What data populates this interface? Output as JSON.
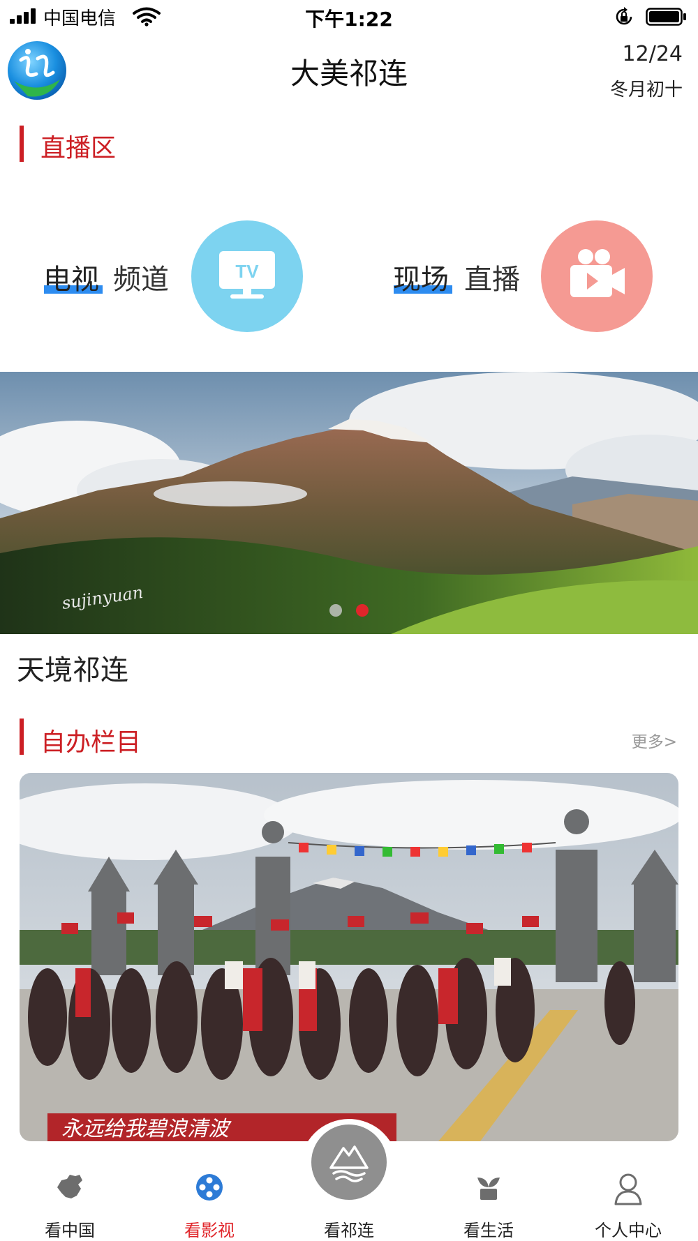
{
  "status_bar": {
    "carrier": "中国电信",
    "time": "下午1:22",
    "icons": [
      "signal-icon",
      "wifi-icon",
      "rotation-lock-icon",
      "battery-icon"
    ]
  },
  "header": {
    "title": "大美祁连",
    "date": "12/24",
    "lunar_date": "冬月初十",
    "logo_icon": "app-logo"
  },
  "live_section": {
    "title": "直播区",
    "items": [
      {
        "strong": "电视",
        "light": "频道",
        "icon_label": "TV",
        "icon": "tv-icon",
        "color": "#7dd3f0"
      },
      {
        "strong": "现场",
        "light": "直播",
        "icon": "video-camera-icon",
        "color": "#f59a93"
      }
    ]
  },
  "banner": {
    "watermark": "sujinyuan",
    "caption": "天境祁连",
    "pagination": {
      "count": 2,
      "active": 2,
      "active_color": "#e0262b"
    }
  },
  "program_section": {
    "title": "自办栏目",
    "more": "更多>",
    "subtitle": "永远给我碧浪清波"
  },
  "bottom_nav": {
    "items": [
      {
        "label": "看中国",
        "icon": "china-map-icon",
        "active": false
      },
      {
        "label": "看影视",
        "icon": "film-reel-icon",
        "active": true
      },
      {
        "label": "看祁连",
        "icon": "mountain-lake-icon",
        "active": false
      },
      {
        "label": "看生活",
        "icon": "sprout-icon",
        "active": false
      },
      {
        "label": "个人中心",
        "icon": "user-icon",
        "active": false
      }
    ],
    "active_color": "#e0262b"
  },
  "colors": {
    "accent": "#cc1f24",
    "underline": "#2d8cf0"
  }
}
